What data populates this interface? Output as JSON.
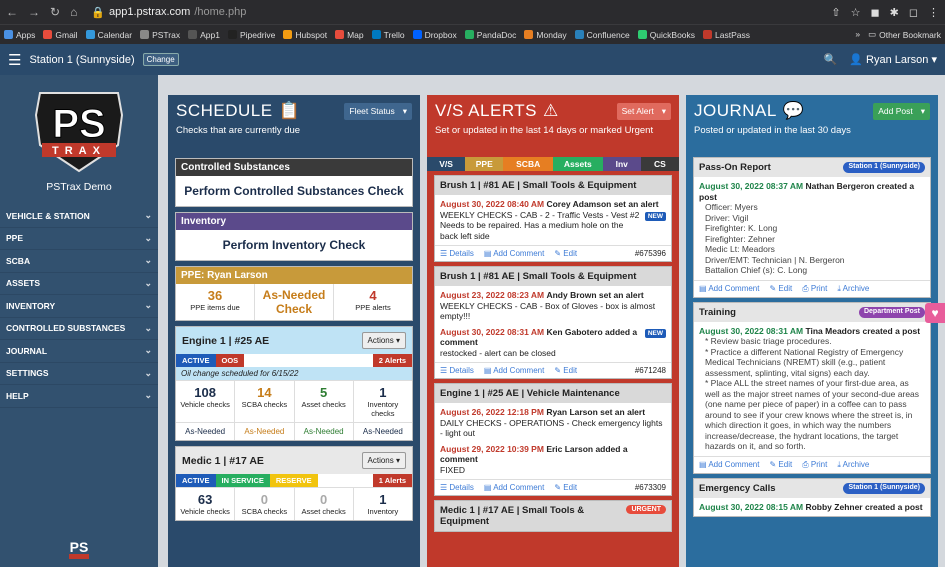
{
  "browser": {
    "url_domain": "app1.pstrax.com",
    "url_path": "/home.php",
    "bookmarks": [
      "Apps",
      "Gmail",
      "Calendar",
      "PSTrax",
      "App1",
      "Pipedrive",
      "Hubspot",
      "Map",
      "Trello",
      "Dropbox",
      "PandaDoc",
      "Monday",
      "Confluence",
      "QuickBooks",
      "LastPass"
    ],
    "other_bookmarks": "Other Bookmark"
  },
  "appbar": {
    "station": "Station 1 (Sunnyside)",
    "change_label": "Change",
    "user": "Ryan Larson"
  },
  "sidebar": {
    "logo_text": "PS",
    "logo_band": "TRAX",
    "org_name": "PSTrax Demo",
    "items": [
      {
        "label": "VEHICLE & STATION"
      },
      {
        "label": "PPE"
      },
      {
        "label": "SCBA"
      },
      {
        "label": "ASSETS"
      },
      {
        "label": "INVENTORY"
      },
      {
        "label": "CONTROLLED SUBSTANCES"
      },
      {
        "label": "JOURNAL"
      },
      {
        "label": "SETTINGS"
      },
      {
        "label": "HELP"
      }
    ],
    "footer_logo": "PS"
  },
  "schedule": {
    "title": "SCHEDULE",
    "subtitle": "Checks that are currently due",
    "fleet_btn": "Fleet Status",
    "cs_header": "Controlled Substances",
    "cs_link": "Perform Controlled Substances Check",
    "inv_header": "Inventory",
    "inv_link": "Perform Inventory Check",
    "ppe_header": "PPE: Ryan Larson",
    "ppe_due_num": "36",
    "ppe_due_label": "PPE items due",
    "ppe_asneeded": "As-Needed Check",
    "ppe_alerts_num": "4",
    "ppe_alerts_label": "PPE alerts",
    "engine": {
      "name": "Engine 1 | #25 AE",
      "actions": "Actions",
      "tag1": "ACTIVE",
      "tag2": "OOS",
      "alerts": "2 Alerts",
      "note": "Oil change scheduled for 6/15/22",
      "vehicle_num": "108",
      "vehicle_lbl": "Vehicle checks",
      "scba_num": "14",
      "scba_lbl": "SCBA checks",
      "asset_num": "5",
      "asset_lbl": "Asset checks",
      "inv_num": "1",
      "inv_lbl": "Inventory checks",
      "asneeded": "As-Needed"
    },
    "medic": {
      "name": "Medic 1 | #17 AE",
      "actions": "Actions",
      "tag1": "ACTIVE",
      "tag2": "IN SERVICE",
      "tag3": "RESERVE",
      "alerts": "1 Alerts",
      "vehicle_num": "63",
      "vehicle_lbl": "Vehicle checks",
      "scba_num": "0",
      "scba_lbl": "SCBA checks",
      "asset_num": "0",
      "asset_lbl": "Asset checks",
      "inv_num": "1",
      "inv_lbl": "Inventory"
    }
  },
  "alerts": {
    "title": "V/S ALERTS",
    "subtitle": "Set or updated in the last 14 days or marked Urgent",
    "set_btn": "Set Alert",
    "tabs": [
      "V/S",
      "PPE",
      "SCBA",
      "Assets",
      "Inv",
      "CS"
    ],
    "a1": {
      "header": "Brush 1 | #81 AE | Small Tools & Equipment",
      "date": "August 30, 2022 08:40 AM",
      "who": "Corey Adamson set an alert",
      "text": "WEEKLY CHECKS - CAB - 2 - Traffic Vests - Vest #2 Needs to be repaired. Has a medium hole on the back left side",
      "new": "NEW",
      "id": "#675396"
    },
    "a2": {
      "header": "Brush 1 | #81 AE | Small Tools & Equipment",
      "date": "August 23, 2022 08:23 AM",
      "who": "Andy Brown set an alert",
      "text": "WEEKLY CHECKS - CAB - Box of Gloves - box is almost empty!!!",
      "date2": "August 30, 2022 08:31 AM",
      "who2": "Ken Gabotero added a comment",
      "text2": "restocked - alert can be closed",
      "new": "NEW",
      "id": "#671248"
    },
    "a3": {
      "header": "Engine 1 | #25 AE | Vehicle Maintenance",
      "date": "August 26, 2022 12:18 PM",
      "who": "Ryan Larson set an alert",
      "text": "DAILY CHECKS - OPERATIONS - Check emergency lights - light out",
      "date2": "August 29, 2022 10:39 PM",
      "who2": "Eric Larson added a comment",
      "text2": "FIXED",
      "id": "#673309"
    },
    "a4": {
      "header": "Medic 1 | #17 AE | Small Tools & Equipment",
      "urgent": "URGENT"
    },
    "details": "Details",
    "add_comment": "Add Comment",
    "edit": "Edit"
  },
  "journal": {
    "title": "JOURNAL",
    "subtitle": "Posted or updated in the last 30 days",
    "add_btn": "Add Post",
    "p1": {
      "header": "Pass-On Report",
      "badge": "Station 1 (Sunnyside)",
      "date": "August 30, 2022 08:37 AM",
      "who": "Nathan Bergeron created a post",
      "lines": [
        "Officer: Myers",
        "Driver: Vigil",
        "Firefighter: K. Long",
        "Firefighter: Zehner",
        "Medic Lt: Meadors",
        "Driver/EMT: Technician | N. Bergeron",
        "Battalion Chief (s): C. Long"
      ]
    },
    "p2": {
      "header": "Training",
      "badge": "Department Post",
      "date": "August 30, 2022 08:31 AM",
      "who": "Tina Meadors created a post",
      "lines": [
        "* Review basic triage procedures.",
        "* Practice a different National Registry of Emergency Medical Technicians (NREMT) skill (e.g., patient assessment, splinting, vital signs) each day.",
        "* Place ALL the street names of your first-due area, as well as the major street names of your second-due areas (one name per piece of paper) in a coffee can to pass around to see if your crew knows where the street is, in which direction it goes, in which way the numbers increase/decrease, the hydrant locations, the target hazards on it, and so forth."
      ]
    },
    "p3": {
      "header": "Emergency Calls",
      "badge": "Station 1 (Sunnyside)",
      "date": "August 30, 2022 08:15 AM",
      "who": "Robby Zehner created a post"
    },
    "add_comment": "Add Comment",
    "edit": "Edit",
    "print": "Print",
    "archive": "Archive"
  },
  "colors": {
    "schedule_head": "#2a4a6b",
    "alerts_head": "#c0392b",
    "journal_head": "#2b6d9e",
    "sidebar": "#32516f"
  }
}
